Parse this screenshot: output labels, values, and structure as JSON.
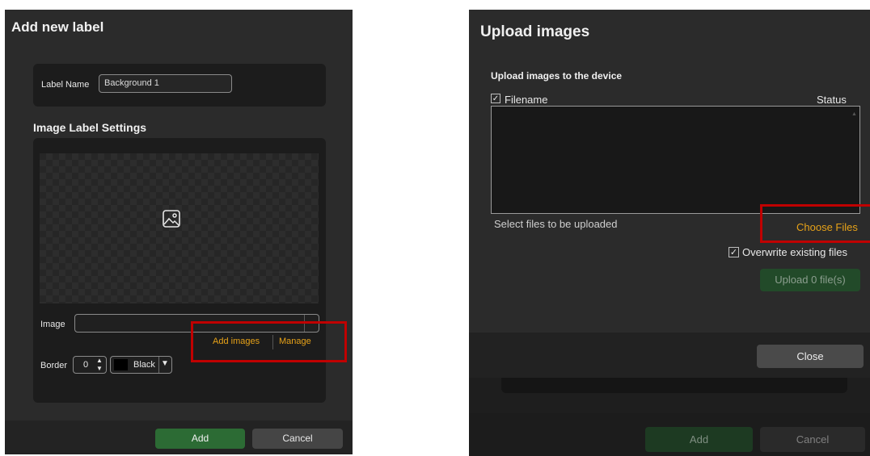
{
  "add_label_dialog": {
    "title": "Add new label",
    "label_name_label": "Label Name",
    "label_name_value": "Background 1",
    "settings_heading": "Image Label Settings",
    "preview_icon": "image-placeholder-icon",
    "image_label": "Image",
    "image_select_value": "",
    "image_select_arrow": "⋯",
    "add_images_link": "Add images",
    "manage_link": "Manage",
    "border_label": "Border",
    "border_width_value": "0",
    "border_color_name": "Black",
    "border_color_hex": "#000000",
    "add_button": "Add",
    "cancel_button": "Cancel"
  },
  "upload_dialog": {
    "title": "Upload images",
    "subtitle": "Upload images to the device",
    "filename_checked": true,
    "filename_header": "Filename",
    "status_header": "Status",
    "files": [],
    "select_hint": "Select files to be uploaded",
    "choose_files_link": "Choose Files",
    "overwrite_checked": true,
    "overwrite_label": "Overwrite existing files",
    "upload_button": "Upload 0 file(s)",
    "close_button": "Close"
  },
  "background_dialog": {
    "add_button": "Add",
    "cancel_button": "Cancel"
  },
  "colors": {
    "accent_orange": "#e7a218",
    "primary_green": "#2c6b34",
    "highlight_red": "#c00000",
    "panel_dark": "#2b2b2b",
    "card_dark": "#1c1c1c"
  }
}
